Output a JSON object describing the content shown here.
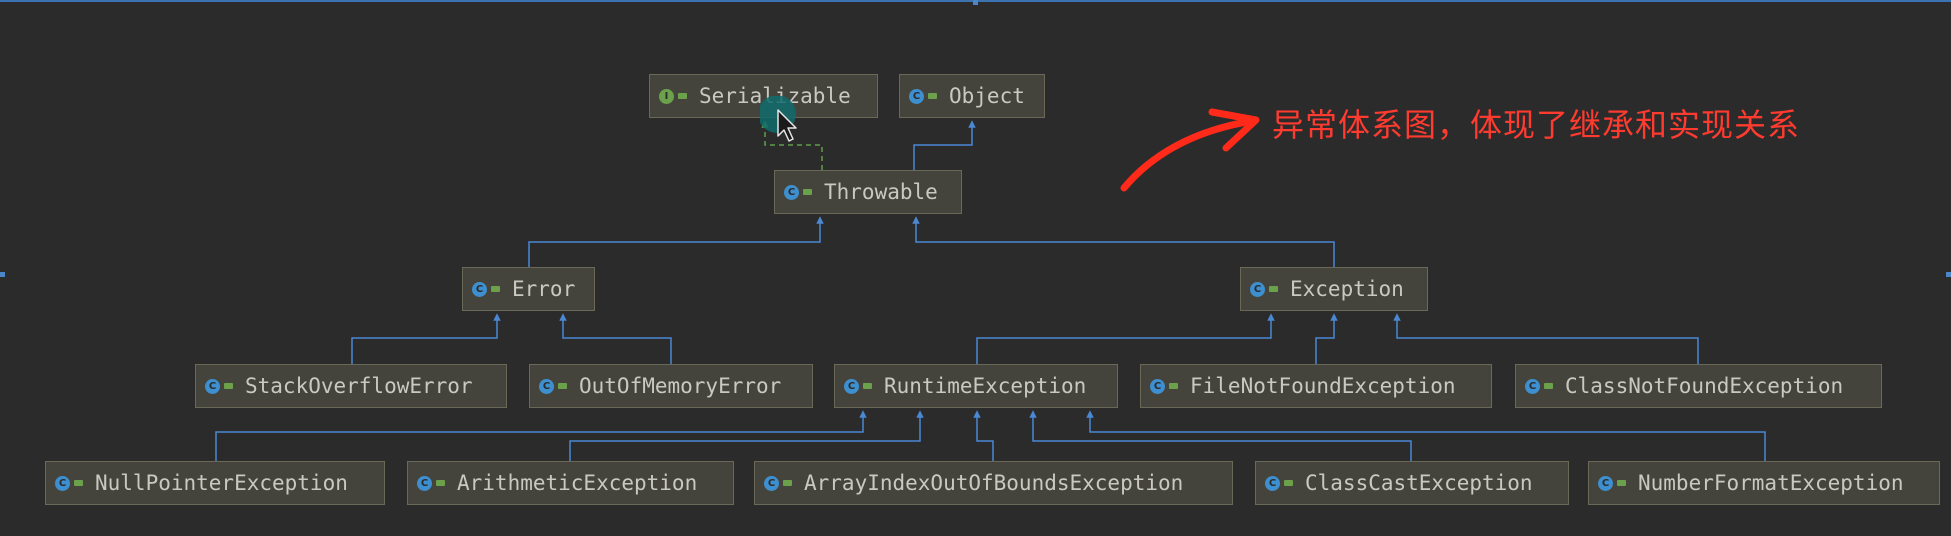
{
  "annotation": {
    "text": "异常体系图，体现了继承和实现关系",
    "color": "#ff3b30"
  },
  "colors": {
    "extends_edge": "#4a88d4",
    "implements_edge": "#5f9e4a",
    "node_bg": "#45443c"
  },
  "nodes": {
    "serializable": {
      "name": "Serializable",
      "kind": "interface",
      "icon": "interface-icon"
    },
    "object": {
      "name": "Object",
      "kind": "class",
      "icon": "class-icon"
    },
    "throwable": {
      "name": "Throwable",
      "kind": "class",
      "icon": "class-icon"
    },
    "error": {
      "name": "Error",
      "kind": "class",
      "icon": "class-icon"
    },
    "exception": {
      "name": "Exception",
      "kind": "class",
      "icon": "class-icon"
    },
    "stack_overflow_error": {
      "name": "StackOverflowError",
      "kind": "class",
      "icon": "class-icon"
    },
    "out_of_memory_error": {
      "name": "OutOfMemoryError",
      "kind": "class",
      "icon": "class-icon"
    },
    "runtime_exception": {
      "name": "RuntimeException",
      "kind": "class",
      "icon": "class-icon"
    },
    "file_not_found_exception": {
      "name": "FileNotFoundException",
      "kind": "class",
      "icon": "class-icon"
    },
    "class_not_found_exception": {
      "name": "ClassNotFoundException",
      "kind": "class",
      "icon": "class-icon"
    },
    "null_pointer_exception": {
      "name": "NullPointerException",
      "kind": "class",
      "icon": "class-icon"
    },
    "arithmetic_exception": {
      "name": "ArithmeticException",
      "kind": "class",
      "icon": "class-icon"
    },
    "array_index_out_of_bounds_exception": {
      "name": "ArrayIndexOutOfBoundsException",
      "kind": "class",
      "icon": "class-icon"
    },
    "class_cast_exception": {
      "name": "ClassCastException",
      "kind": "class",
      "icon": "class-icon"
    },
    "number_format_exception": {
      "name": "NumberFormatException",
      "kind": "class",
      "icon": "class-icon"
    }
  },
  "relations": [
    {
      "child": "throwable",
      "parent": "serializable",
      "type": "implements"
    },
    {
      "child": "throwable",
      "parent": "object",
      "type": "extends"
    },
    {
      "child": "error",
      "parent": "throwable",
      "type": "extends"
    },
    {
      "child": "exception",
      "parent": "throwable",
      "type": "extends"
    },
    {
      "child": "stack_overflow_error",
      "parent": "error",
      "type": "extends"
    },
    {
      "child": "out_of_memory_error",
      "parent": "error",
      "type": "extends"
    },
    {
      "child": "runtime_exception",
      "parent": "exception",
      "type": "extends"
    },
    {
      "child": "file_not_found_exception",
      "parent": "exception",
      "type": "extends"
    },
    {
      "child": "class_not_found_exception",
      "parent": "exception",
      "type": "extends"
    },
    {
      "child": "null_pointer_exception",
      "parent": "runtime_exception",
      "type": "extends"
    },
    {
      "child": "arithmetic_exception",
      "parent": "runtime_exception",
      "type": "extends"
    },
    {
      "child": "array_index_out_of_bounds_exception",
      "parent": "runtime_exception",
      "type": "extends"
    },
    {
      "child": "class_cast_exception",
      "parent": "runtime_exception",
      "type": "extends"
    },
    {
      "child": "number_format_exception",
      "parent": "runtime_exception",
      "type": "extends"
    }
  ]
}
